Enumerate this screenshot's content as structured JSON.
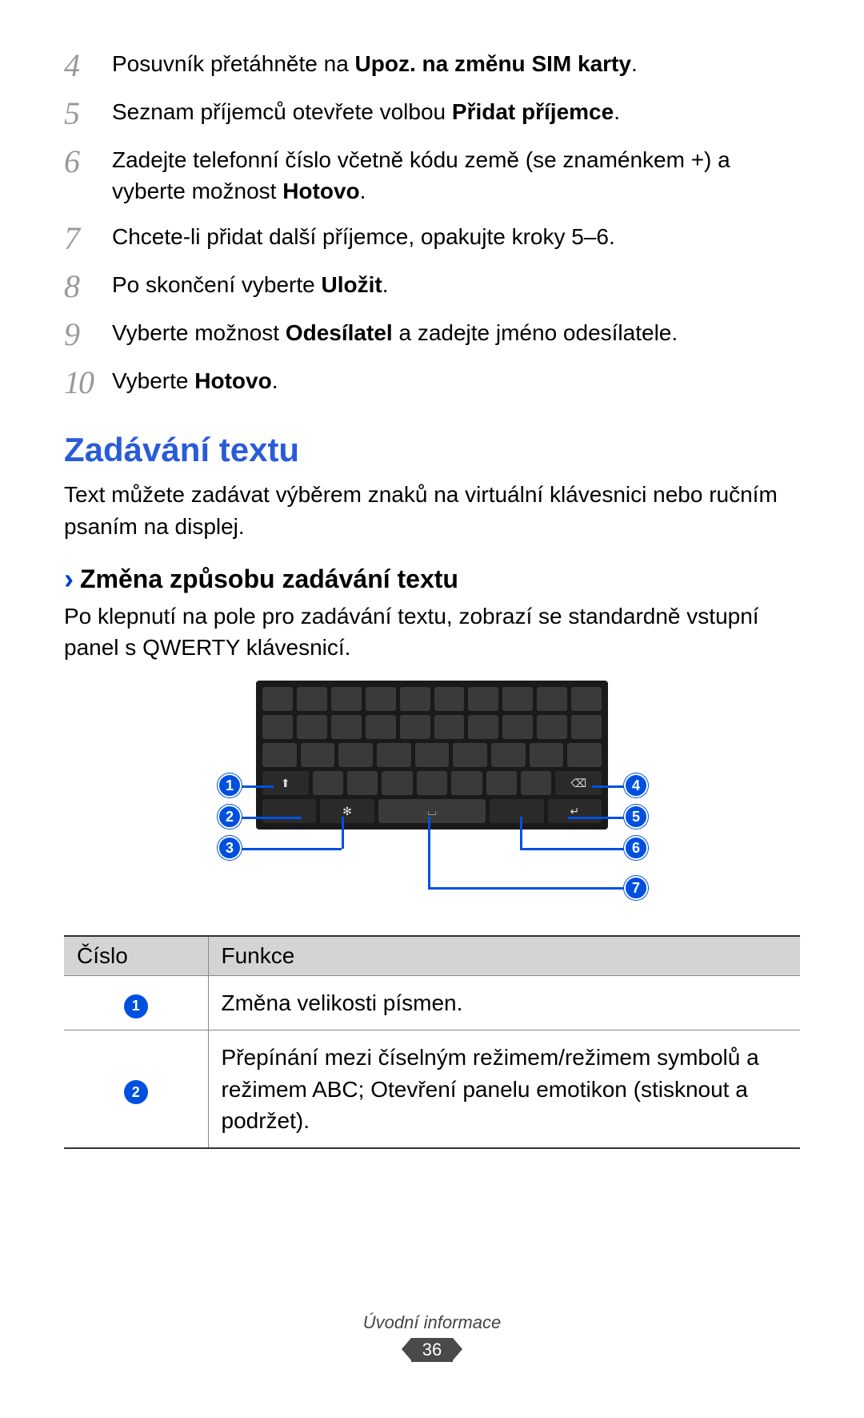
{
  "steps": [
    {
      "num": "4",
      "text_a": "Posuvník přetáhněte na ",
      "bold_a": "Upoz. na změnu SIM karty",
      "text_b": "."
    },
    {
      "num": "5",
      "text_a": "Seznam příjemců otevřete volbou ",
      "bold_a": "Přidat příjemce",
      "text_b": "."
    },
    {
      "num": "6",
      "text_a": "Zadejte telefonní číslo včetně kódu země (se znaménkem +) a vyberte možnost ",
      "bold_a": "Hotovo",
      "text_b": "."
    },
    {
      "num": "7",
      "text_a": "Chcete-li přidat další příjemce, opakujte kroky 5–6.",
      "bold_a": "",
      "text_b": ""
    },
    {
      "num": "8",
      "text_a": "Po skončení vyberte ",
      "bold_a": "Uložit",
      "text_b": "."
    },
    {
      "num": "9",
      "text_a": "Vyberte možnost ",
      "bold_a": "Odesílatel",
      "text_b": " a zadejte jméno odesílatele."
    },
    {
      "num": "10",
      "text_a": "Vyberte ",
      "bold_a": "Hotovo",
      "text_b": "."
    }
  ],
  "section": {
    "title": "Zadávání textu",
    "desc": "Text můžete zadávat výběrem znaků na virtuální klávesnici nebo ručním psaním na displej."
  },
  "subsection": {
    "title": "Změna způsobu zadávání textu",
    "desc": "Po klepnutí na pole pro zadávání textu, zobrazí se standardně vstupní panel s QWERTY klávesnicí."
  },
  "callouts": [
    "1",
    "2",
    "3",
    "4",
    "5",
    "6",
    "7"
  ],
  "table": {
    "headers": [
      "Číslo",
      "Funkce"
    ],
    "rows": [
      {
        "num": "1",
        "desc": "Změna velikosti písmen."
      },
      {
        "num": "2",
        "desc": "Přepínání mezi číselným režimem/režimem symbolů a režimem ABC; Otevření panelu emotikon (stisknout a podržet)."
      }
    ]
  },
  "footer": {
    "section": "Úvodní informace",
    "page": "36"
  },
  "icons": {
    "shift": "⬆",
    "backspace": "⌫",
    "gear": "✻",
    "space": "⌴",
    "enter": "↵"
  }
}
